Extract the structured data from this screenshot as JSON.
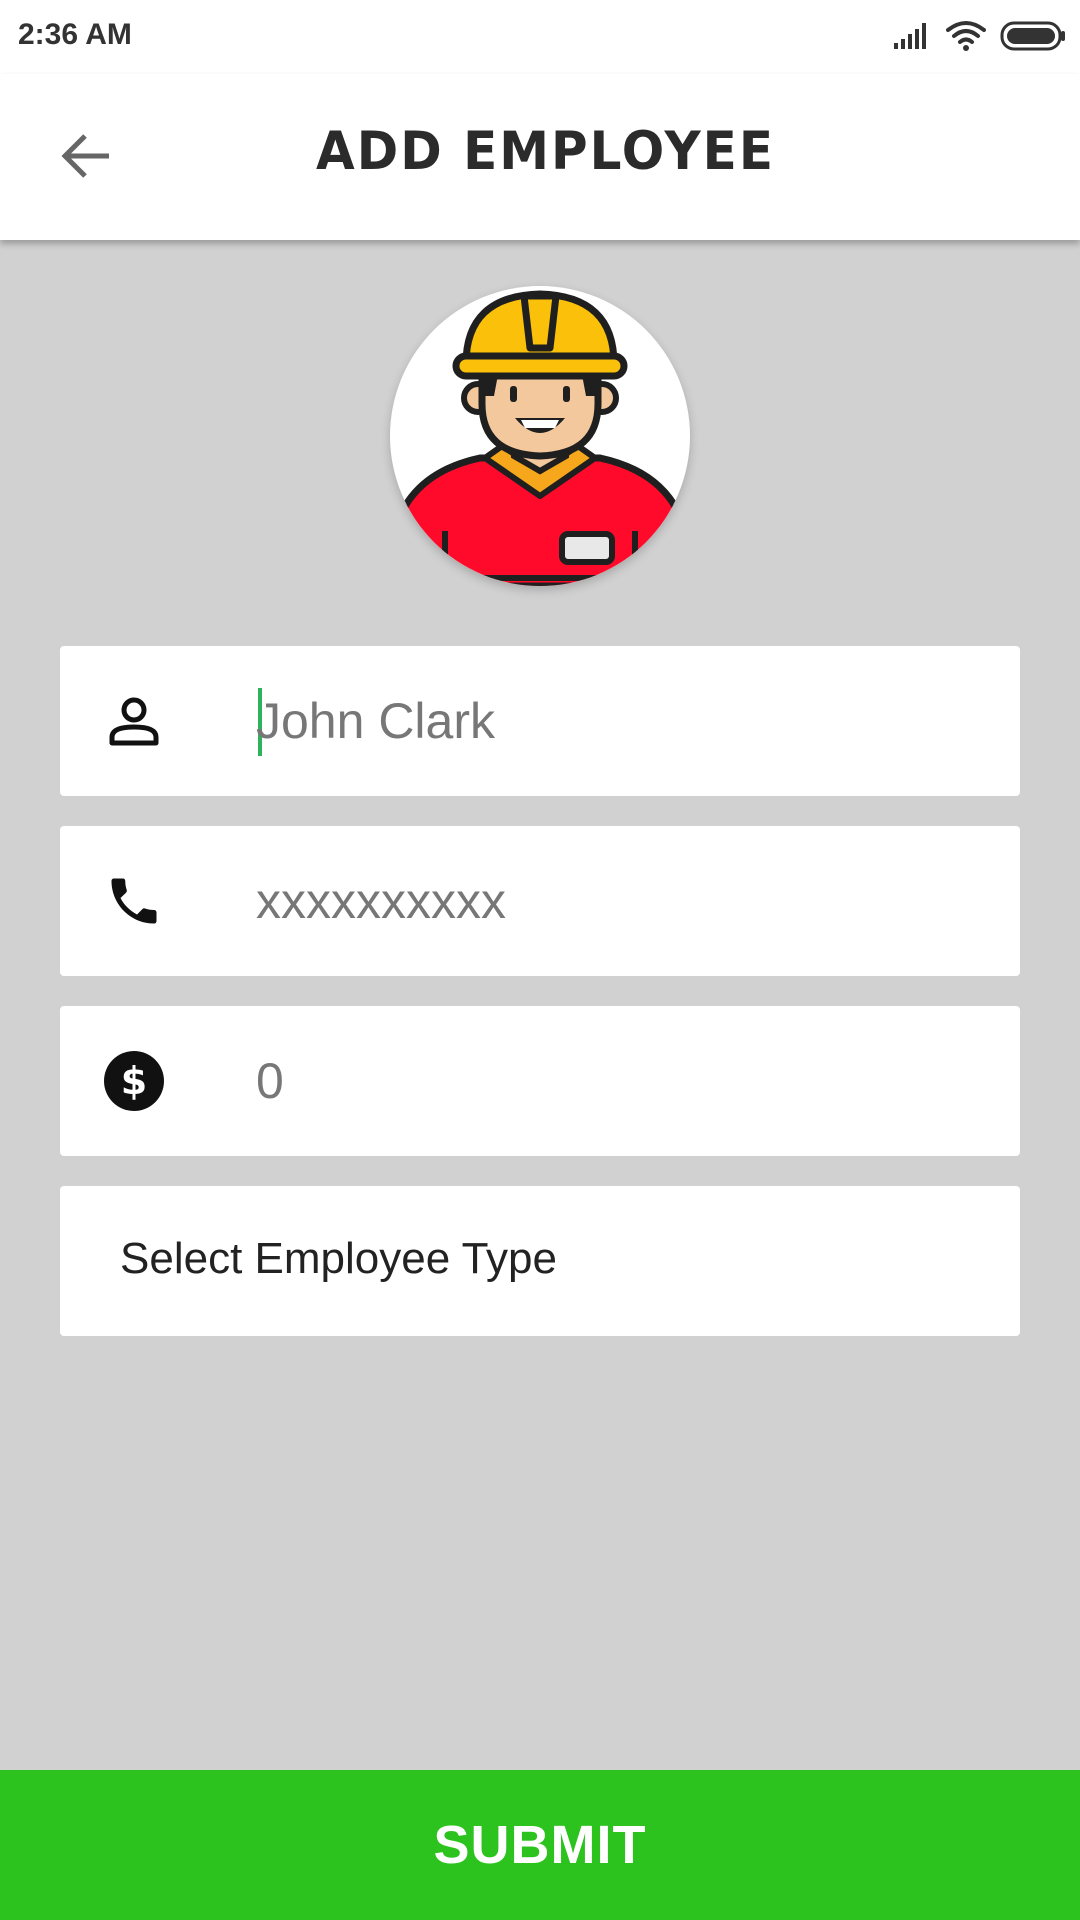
{
  "status_bar": {
    "time": "2:36 AM",
    "icons": [
      "signal-icon",
      "wifi-icon",
      "battery-icon"
    ]
  },
  "app_bar": {
    "back_icon": "arrow-back-icon",
    "title": "ADD EMPLOYEE"
  },
  "avatar": {
    "icon": "construction-worker-avatar"
  },
  "form": {
    "name": {
      "icon": "person-icon",
      "value": "",
      "placeholder": "John Clark"
    },
    "phone": {
      "icon": "phone-icon",
      "value": "",
      "placeholder": "xxxxxxxxxx"
    },
    "salary": {
      "icon": "dollar-icon",
      "value": "",
      "placeholder": "0"
    },
    "employee_type": {
      "label": "Select Employee Type"
    }
  },
  "submit": {
    "label": "SUBMIT"
  },
  "colors": {
    "accent": "#2cc31e",
    "background": "#d1d1d2",
    "cursor": "#2fb35a"
  }
}
